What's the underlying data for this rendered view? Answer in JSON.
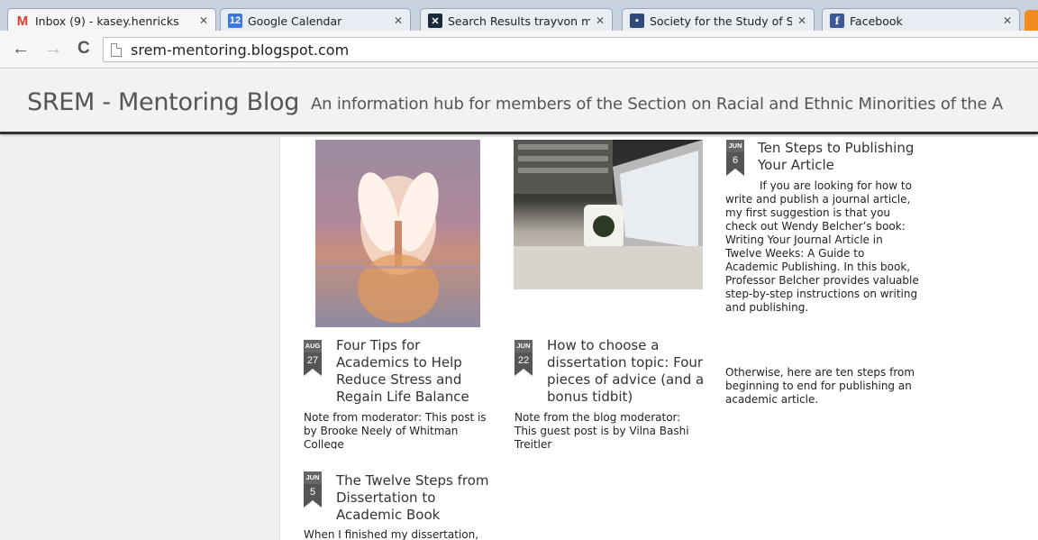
{
  "browser": {
    "tabs": [
      {
        "title": "Inbox (9) - kasey.henricks",
        "icon": "gmail-icon"
      },
      {
        "title": "Google Calendar",
        "icon": "calendar-icon",
        "icon_text": "12"
      },
      {
        "title": "Search Results trayvon ma",
        "icon": "x-site-icon"
      },
      {
        "title": "Society for the Study of Sc",
        "icon": "society-icon"
      },
      {
        "title": "Facebook",
        "icon": "facebook-icon",
        "icon_text": "f"
      }
    ],
    "url": "srem-mentoring.blogspot.com"
  },
  "blog": {
    "title": "SREM - Mentoring Blog",
    "description": "An information hub for members of the Section on Racial and Ethnic Minorities of the A"
  },
  "posts": [
    {
      "month": "AUG",
      "day": "27",
      "title": "Four Tips for Academics to Help Reduce Stress and Regain Life Balance",
      "snippet": "Note from moderator: This post is by Brooke Neely of Whitman College"
    },
    {
      "month": "JUN",
      "day": "22",
      "title": "How to choose a dissertation topic: Four pieces of advice (and a bonus tidbit)",
      "snippet": "Note from the blog moderator: This guest post is by Vilna Bashi Treitler"
    },
    {
      "month": "JUN",
      "day": "6",
      "title": "Ten Steps to Publishing Your Article",
      "snippet_p1": "If you are looking for how to write and publish a journal article, my first suggestion is that you check out Wendy Belcher’s book: Writing Your Journal Article in Twelve Weeks: A Guide to Academic Publishing. In this book, Professor Belcher provides valuable step-by-step instructions on writing and publishing.",
      "snippet_p2": "Otherwise, here are ten steps from beginning to end for publishing an academic article."
    },
    {
      "month": "JUN",
      "day": "5",
      "title": "The Twelve Steps from Dissertation to Academic Book",
      "snippet": "When I finished my dissertation,"
    }
  ]
}
